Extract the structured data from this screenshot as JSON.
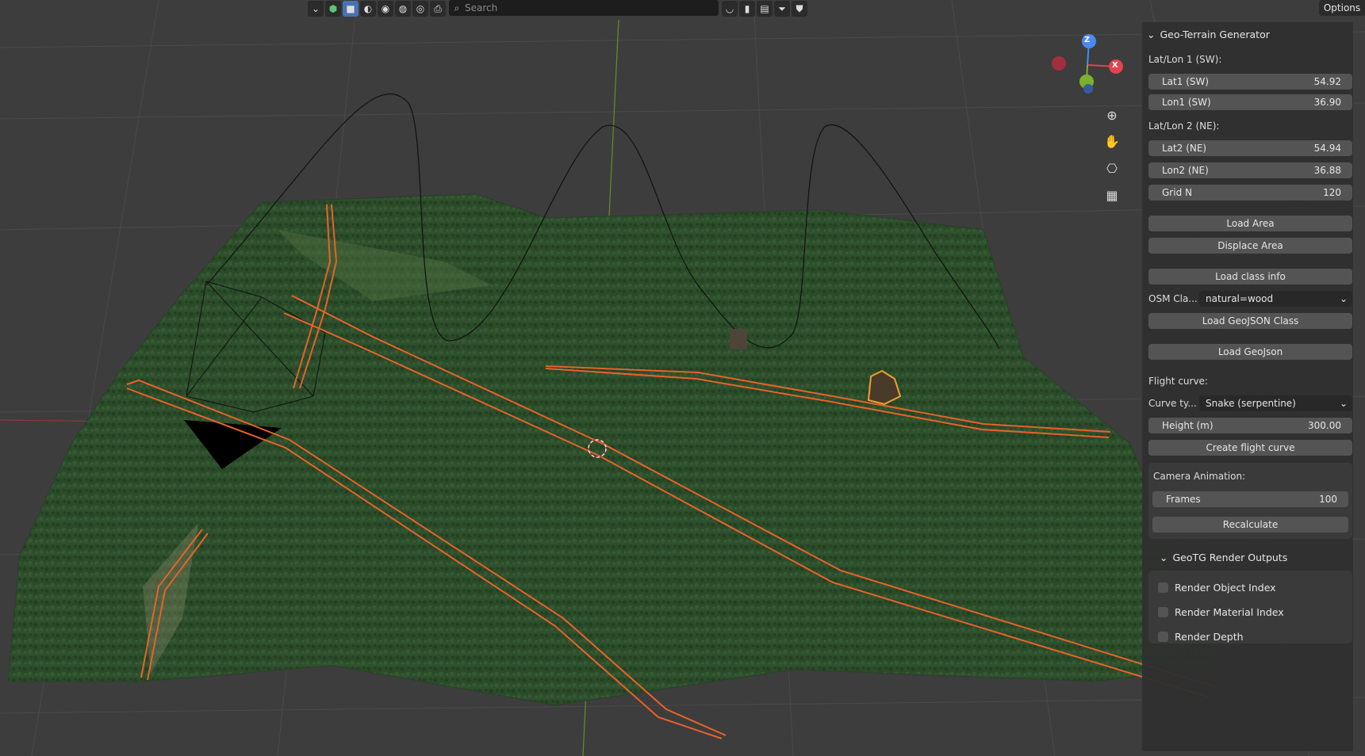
{
  "header": {
    "search_placeholder": "Search",
    "options_label": "Options"
  },
  "icons": [
    "chevron-down-icon",
    "object-icon",
    "select-box-icon",
    "wireframe-icon",
    "solid-icon",
    "material-icon",
    "rendered-icon",
    "printer-icon",
    "magnifier-icon",
    "overlay-icon",
    "bookmark-icon",
    "layout-icon",
    "filter-icon",
    "shield-icon",
    "zoom-icon",
    "hand-icon",
    "camera-icon",
    "grid-icon"
  ],
  "gizmo": {
    "z_label": "Z",
    "x_label": "X"
  },
  "panel": {
    "title": "Geo-Terrain Generator",
    "latlon1_label": "Lat/Lon 1 (SW):",
    "lat1": {
      "label": "Lat1 (SW)",
      "value": "54.92"
    },
    "lon1": {
      "label": "Lon1 (SW)",
      "value": "36.90"
    },
    "latlon2_label": "Lat/Lon 2 (NE):",
    "lat2": {
      "label": "Lat2 (NE)",
      "value": "54.94"
    },
    "lon2": {
      "label": "Lon2 (NE)",
      "value": "36.88"
    },
    "grid": {
      "label": "Grid N",
      "value": "120"
    },
    "load_area": "Load Area",
    "displace_area": "Displace Area",
    "load_class_info": "Load class info",
    "osm_label": "OSM Cla...",
    "osm_value": "natural=wood",
    "load_geojson_class": "Load GeoJSON Class",
    "load_geojson": "Load GeoJson",
    "flight_curve_label": "Flight curve:",
    "curve_type_label": "Curve ty...",
    "curve_type_value": "Snake (serpentine)",
    "height": {
      "label": "Height (m)",
      "value": "300.00"
    },
    "create_flight_curve": "Create flight curve",
    "camera_animation_label": "Camera Animation:",
    "frames": {
      "label": "Frames",
      "value": "100"
    },
    "recalculate": "Recalculate",
    "render_outputs_title": "GeoTG Render Outputs",
    "render_object_index": "Render Object Index",
    "render_material_index": "Render Material Index",
    "render_depth": "Render Depth"
  }
}
